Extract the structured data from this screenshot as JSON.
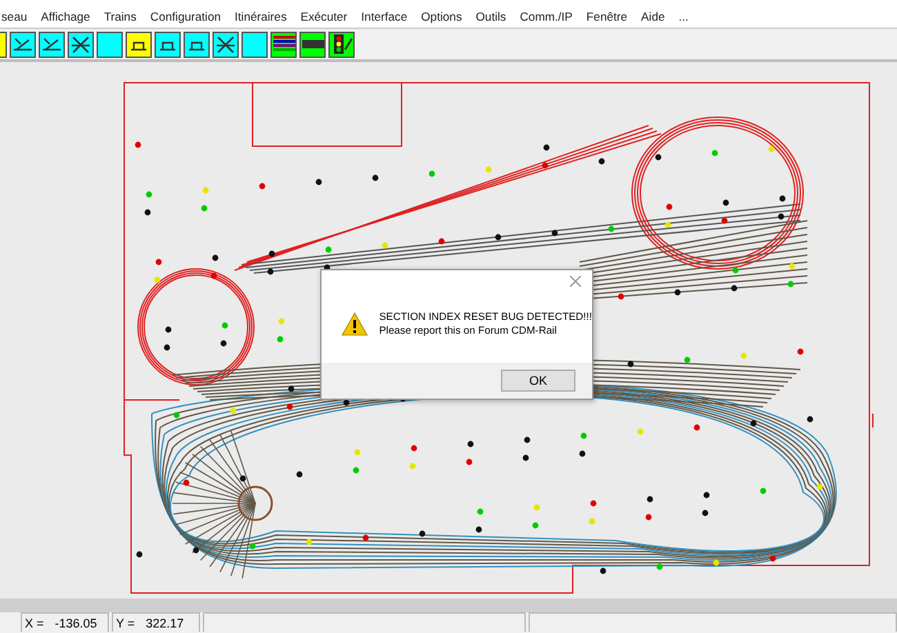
{
  "menu": [
    {
      "label": "seau"
    },
    {
      "label": "Affichage"
    },
    {
      "label": "Trains"
    },
    {
      "label": "Configuration"
    },
    {
      "label": "Itinéraires"
    },
    {
      "label": "Exécuter"
    },
    {
      "label": "Interface"
    },
    {
      "label": "Options"
    },
    {
      "label": "Outils"
    },
    {
      "label": "Comm./IP"
    },
    {
      "label": "Fenêtre"
    },
    {
      "label": "Aide"
    },
    {
      "label": "..."
    }
  ],
  "toolbar": [
    {
      "kind": "blank",
      "color": "#ffff00"
    },
    {
      "kind": "switch",
      "color": "#00ffff"
    },
    {
      "kind": "switch",
      "color": "#00ffff"
    },
    {
      "kind": "cross",
      "color": "#00ffff"
    },
    {
      "kind": "blank",
      "color": "#00ffff"
    },
    {
      "kind": "platform",
      "color": "#ffff00"
    },
    {
      "kind": "platform",
      "color": "#00ffff"
    },
    {
      "kind": "platform",
      "color": "#00ffff"
    },
    {
      "kind": "cross",
      "color": "#00ffff"
    },
    {
      "kind": "blank",
      "color": "#00ffff"
    },
    {
      "kind": "rails",
      "color": "#00ff00"
    },
    {
      "kind": "ruler",
      "color": "#00ff00"
    },
    {
      "kind": "signal",
      "color": "#00ff00"
    }
  ],
  "dialog": {
    "message": "SECTION INDEX RESET BUG DETECTED!!!",
    "detail": "Please report this on Forum CDM-Rail",
    "button": "OK"
  },
  "status_bar": {
    "x_label": "X =",
    "x_value": "-136.05",
    "y_label": "Y =",
    "y_value": "322.17"
  }
}
